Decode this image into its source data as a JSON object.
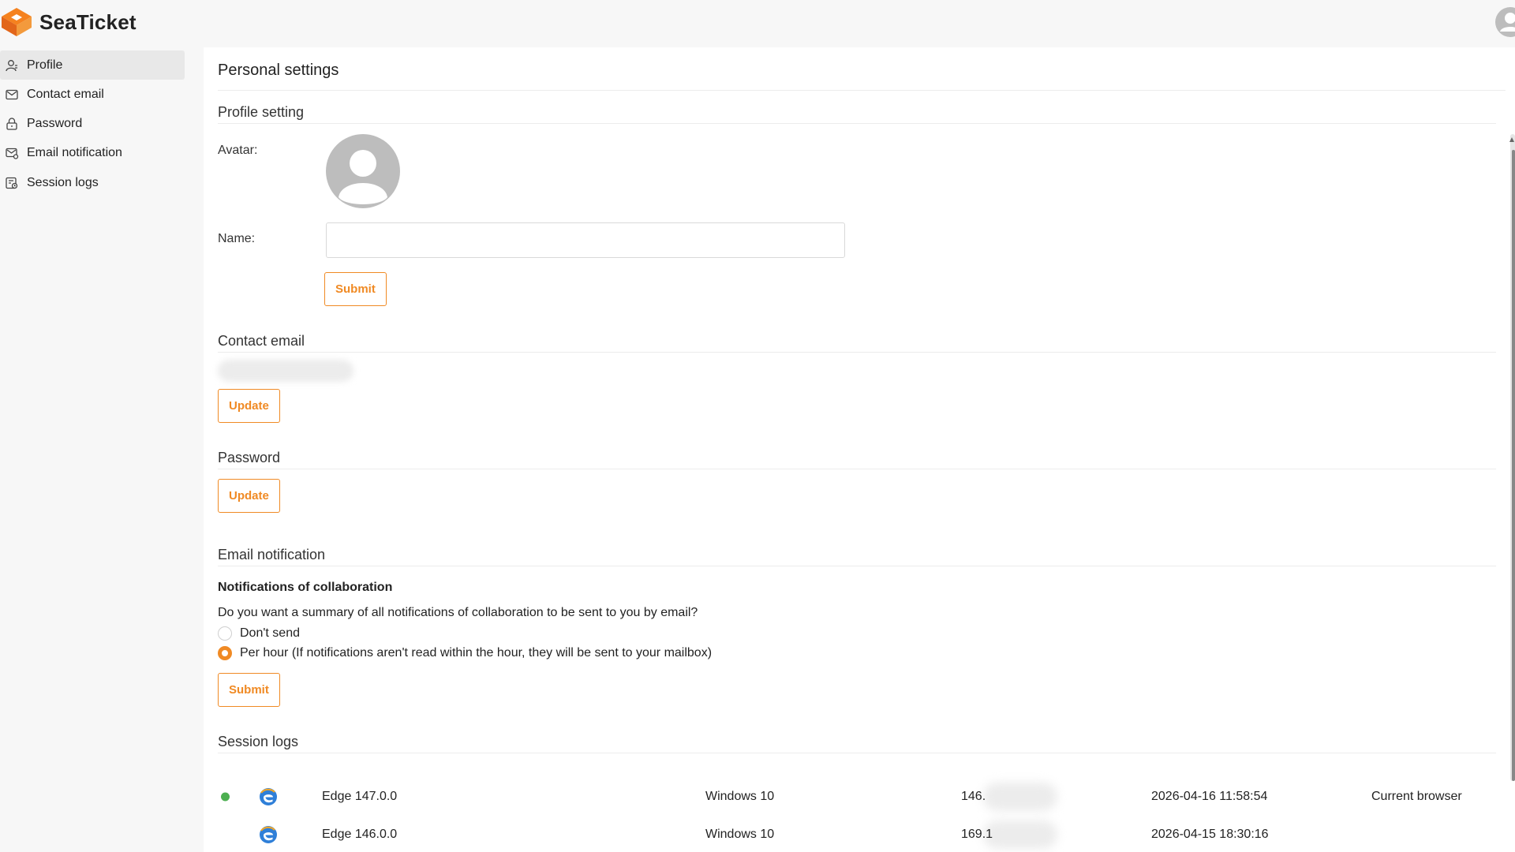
{
  "app": {
    "name": "SeaTicket"
  },
  "colors": {
    "accent": "#f08a24",
    "online": "#4caf50"
  },
  "sidebar": {
    "items": [
      {
        "label": "Profile",
        "icon": "user-icon",
        "active": true
      },
      {
        "label": "Contact email",
        "icon": "mail-icon",
        "active": false
      },
      {
        "label": "Password",
        "icon": "lock-icon",
        "active": false
      },
      {
        "label": "Email notification",
        "icon": "mail-notification-icon",
        "active": false
      },
      {
        "label": "Session logs",
        "icon": "session-log-icon",
        "active": false
      }
    ]
  },
  "main": {
    "page_title": "Personal settings",
    "profile": {
      "section_title": "Profile setting",
      "avatar_label": "Avatar:",
      "name_label": "Name:",
      "name_value": "",
      "submit_label": "Submit"
    },
    "contact_email": {
      "section_title": "Contact email",
      "update_label": "Update"
    },
    "password": {
      "section_title": "Password",
      "update_label": "Update"
    },
    "email_notification": {
      "section_title": "Email notification",
      "subhead": "Notifications of collaboration",
      "question": "Do you want a summary of all notifications of collaboration to be sent to you by email?",
      "options": [
        {
          "label": "Don't send",
          "checked": false
        },
        {
          "label": "Per hour (If notifications aren't read within the hour, they will be sent to your mailbox)",
          "checked": true
        }
      ],
      "submit_label": "Submit"
    },
    "session_logs": {
      "section_title": "Session logs",
      "rows": [
        {
          "browser": "Edge 147.0.0",
          "os": "Windows 10",
          "ip": "146.",
          "time": "2026-04-16 11:58:54",
          "note": "Current browser",
          "current": true
        },
        {
          "browser": "Edge 146.0.0",
          "os": "Windows 10",
          "ip": "169.1",
          "time": "2026-04-15 18:30:16",
          "note": "",
          "current": false
        }
      ]
    }
  }
}
